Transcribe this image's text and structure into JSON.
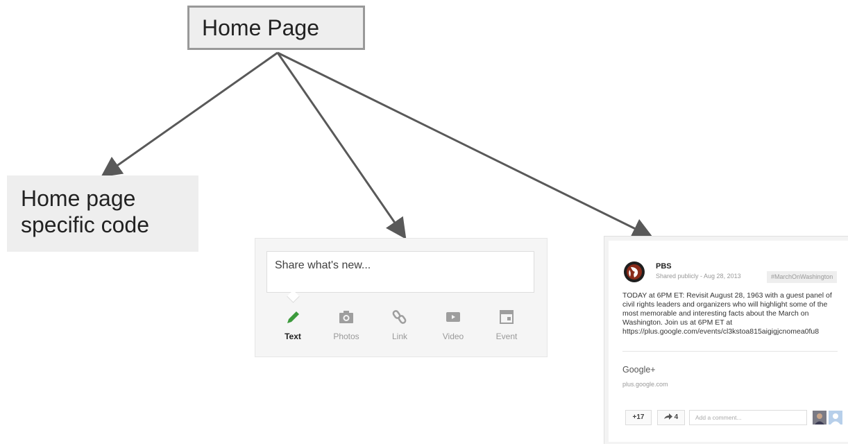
{
  "diagram": {
    "home_label": "Home Page",
    "specific_label_line1": "Home page",
    "specific_label_line2": "specific code"
  },
  "share_box": {
    "placeholder": "Share what's new...",
    "tabs": [
      {
        "label": "Text",
        "icon": "pencil-icon",
        "active": true
      },
      {
        "label": "Photos",
        "icon": "camera-icon",
        "active": false
      },
      {
        "label": "Link",
        "icon": "link-icon",
        "active": false
      },
      {
        "label": "Video",
        "icon": "video-icon",
        "active": false
      },
      {
        "label": "Event",
        "icon": "calendar-icon",
        "active": false
      }
    ],
    "active_color": "#3c9a3c"
  },
  "post": {
    "author": "PBS",
    "meta": "Shared publicly  -  Aug 28, 2013",
    "hashtag": "#MarchOnWashington",
    "body_lines": [
      "TODAY at 6PM ET: Revisit August 28, 1963 with a guest panel of",
      "civil rights leaders and organizers who will highlight some of the",
      "most memorable and interesting facts about the March on",
      "Washington. Join us at 6PM ET at",
      "https://plus.google.com/events/cl3kstoa815aigigjcnomea0fu8"
    ],
    "link_title": "Google+",
    "link_url": "plus.google.com",
    "plus_count": "+17",
    "reshare_count": "4",
    "comment_placeholder": "Add a comment..."
  }
}
